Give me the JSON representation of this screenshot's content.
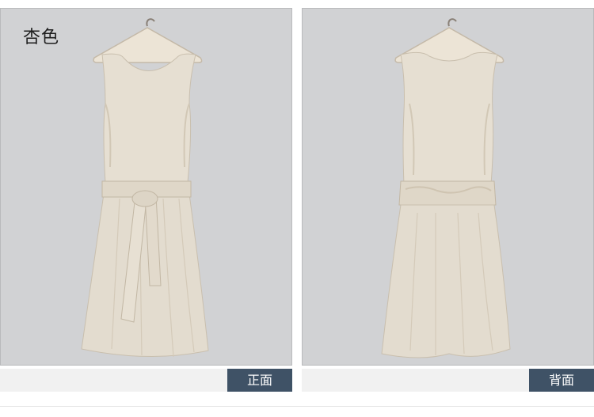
{
  "color_label": "杏色",
  "captions": {
    "front": "正面",
    "back": "背面"
  },
  "colors": {
    "panel_bg": "#d1d2d4",
    "dress": "#e4ddd0",
    "caption_tag": "#3f5266",
    "caption_bar": "#f1f1f1"
  },
  "icons": {
    "hanger": "hanger-icon"
  }
}
